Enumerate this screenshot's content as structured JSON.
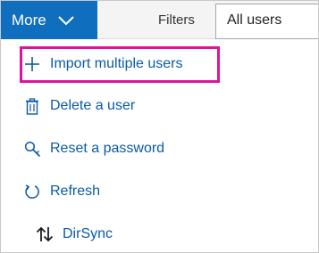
{
  "toolbar": {
    "more_label": "More",
    "filters_label": "Filters",
    "filter_value": "All users"
  },
  "menu": {
    "items": [
      {
        "label": "Import multiple users",
        "icon": "plus-icon",
        "highlighted": true
      },
      {
        "label": "Delete a user",
        "icon": "trash-icon"
      },
      {
        "label": "Reset a password",
        "icon": "key-icon"
      },
      {
        "label": "Refresh",
        "icon": "refresh-icon"
      },
      {
        "label": "DirSync",
        "icon": "sync-arrows-icon"
      }
    ]
  },
  "colors": {
    "accent": "#106ebe",
    "link": "#0a5aa8",
    "highlight": "#e0109a"
  }
}
